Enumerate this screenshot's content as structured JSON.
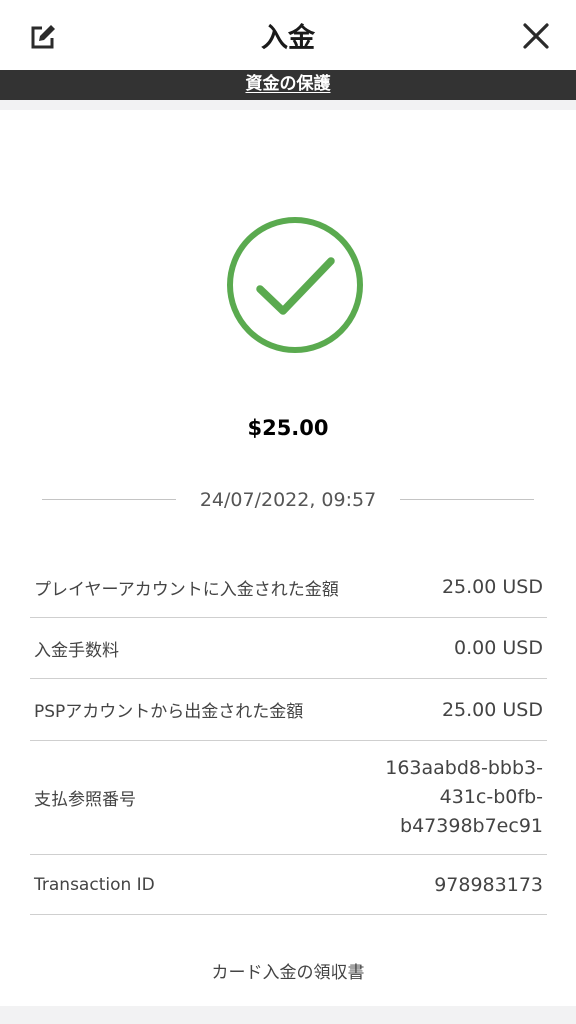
{
  "header": {
    "title": "入金",
    "edit_icon": "edit-icon",
    "close_icon": "close-icon"
  },
  "banner": {
    "link_label": "資金の保護"
  },
  "status": {
    "icon": "check-circle-icon",
    "color": "#5aaa4f"
  },
  "amount": "$25.00",
  "datetime": "24/07/2022, 09:57",
  "details": [
    {
      "label": "プレイヤーアカウントに入金された金額",
      "value": "25.00 USD"
    },
    {
      "label": "入金手数料",
      "value": "0.00 USD"
    },
    {
      "label": "PSPアカウントから出金された金額",
      "value": "25.00 USD"
    },
    {
      "label": "支払参照番号",
      "value": "163aabd8-bbb3-\n431c-b0fb-\nb47398b7ec91"
    },
    {
      "label": "Transaction ID",
      "value": "978983173"
    }
  ],
  "receipt_link": "カード入金の領収書"
}
